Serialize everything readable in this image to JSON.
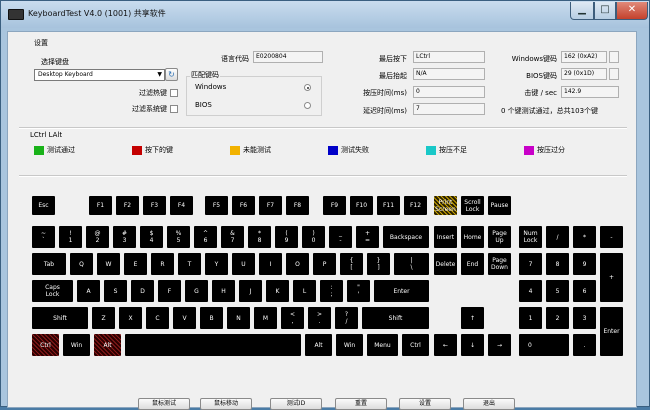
{
  "title": "KeyboardTest V4.0 (1001) 共享软件",
  "settings_label": "设置",
  "keyboard_select": {
    "label": "选择键盘",
    "value": "Desktop Keyboard"
  },
  "filter_hotkeys": "过滤热键",
  "filter_syskeys": "过滤系统键",
  "match_keys": {
    "label": "匹配键码",
    "windows": "Windows",
    "bios": "BIOS",
    "selected": "Windows"
  },
  "lang_code": {
    "label": "语言代码",
    "value": "E0200804"
  },
  "last_down": {
    "label": "最后按下",
    "value": "LCtrl"
  },
  "last_up": {
    "label": "最后抬起",
    "value": "N/A"
  },
  "press_time": {
    "label": "按压时间(ms)",
    "value": "0"
  },
  "latency": {
    "label": "延迟时间(ms)",
    "value": "7"
  },
  "windows_code": {
    "label": "Windows键码",
    "value": "162 (0xA2)"
  },
  "bios_code": {
    "label": "BIOS键码",
    "value": "29 (0x1D)"
  },
  "strikes": {
    "label": "击键 / sec",
    "value": "142.9"
  },
  "summary": "0 个键测试通过，总共103个键",
  "pressed_display": "LCtrl LAlt",
  "legend": [
    {
      "label": "测试通过",
      "color": "#19b219"
    },
    {
      "label": "按下的键",
      "color": "#c40000"
    },
    {
      "label": "未能测试",
      "color": "#f2b200"
    },
    {
      "label": "测试失败",
      "color": "#0000c8"
    },
    {
      "label": "按压不足",
      "color": "#19c8c8"
    },
    {
      "label": "按压过分",
      "color": "#c800c8"
    }
  ],
  "keys": {
    "esc": "Esc",
    "f1": "F1",
    "f2": "F2",
    "f3": "F3",
    "f4": "F4",
    "f5": "F5",
    "f6": "F6",
    "f7": "F7",
    "f8": "F8",
    "f9": "F9",
    "f10": "F10",
    "f11": "F11",
    "f12": "F12",
    "prtsc": "Print\nScreen",
    "scroll": "Scroll\nLock",
    "pause": "Pause",
    "tilde": "~\n`",
    "d1": "!\n1",
    "d2": "@\n2",
    "d3": "#\n3",
    "d4": "$\n4",
    "d5": "%\n5",
    "d6": "^\n6",
    "d7": "&\n7",
    "d8": "*\n8",
    "d9": "(\n9",
    "d0": ")\n0",
    "minus": "_\n-",
    "plus": "+\n=",
    "backspace": "Backspace",
    "insert": "Insert",
    "home": "Home",
    "pgup": "Page\nUp",
    "numlock": "Num\nLock",
    "nslash": "/",
    "nstar": "*",
    "nminus": "-",
    "tab": "Tab",
    "q": "Q",
    "w": "W",
    "e": "E",
    "r": "R",
    "t": "T",
    "y": "Y",
    "u": "U",
    "i": "I",
    "o": "O",
    "p": "P",
    "lbr": "{\n[",
    "rbr": "}\n]",
    "bslash": "|\n\\",
    "delete": "Delete",
    "end": "End",
    "pgdn": "Page\nDown",
    "n7": "7",
    "n8": "8",
    "n9": "9",
    "nplus": "+",
    "caps": "Caps\nLock",
    "a": "A",
    "s": "S",
    "d": "D",
    "f": "F",
    "g": "G",
    "h": "H",
    "j": "J",
    "k": "K",
    "l": "L",
    "semi": ":\n;",
    "quote": "\"\n'",
    "enter": "Enter",
    "n4": "4",
    "n5": "5",
    "n6": "6",
    "lshift": "Shift",
    "z": "Z",
    "x": "X",
    "c": "C",
    "v": "V",
    "b": "B",
    "n": "N",
    "m": "M",
    "comma": "<\n,",
    "period": ">\n.",
    "slash": "?\n/",
    "rshift": "Shift",
    "up": "↑",
    "n1": "1",
    "n2": "2",
    "n3": "3",
    "nenter": "Enter",
    "lctrl": "Ctrl",
    "lwin": "Win",
    "lalt": "Alt",
    "space": "",
    "ralt": "Alt",
    "rwin": "Win",
    "menu": "Menu",
    "rctrl": "Ctrl",
    "left": "←",
    "down": "↓",
    "right": "→",
    "n0": "0",
    "ndot": "."
  },
  "buttons": [
    "鼠标测试",
    "鼠标移动",
    "测试ID",
    "重置",
    "设置",
    "退出"
  ]
}
